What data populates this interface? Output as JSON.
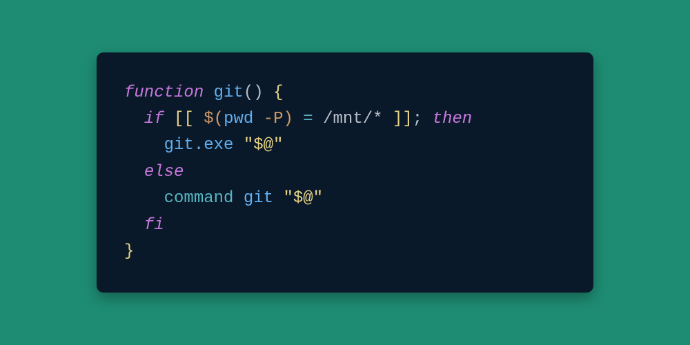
{
  "code": {
    "line1_kw": "function",
    "line1_fn": "git",
    "line1_parens": "()",
    "line1_brace": "{",
    "line2_kw1": "if",
    "line2_bracket1": "[[ ",
    "line2_dollar": "$(",
    "line2_cmd": "pwd",
    "line2_flag": " -P",
    "line2_close": ")",
    "line2_eq": " = ",
    "line2_path": "/mnt/*",
    "line2_bracket2": " ]]",
    "line2_semi": ";",
    "line2_kw2": "then",
    "line3_exe": "git.exe",
    "line3_arg": "\"$@\"",
    "line4_kw": "else",
    "line5_cmd": "command",
    "line5_git": "git",
    "line5_arg": "\"$@\"",
    "line6_kw": "fi",
    "line7_brace": "}"
  }
}
